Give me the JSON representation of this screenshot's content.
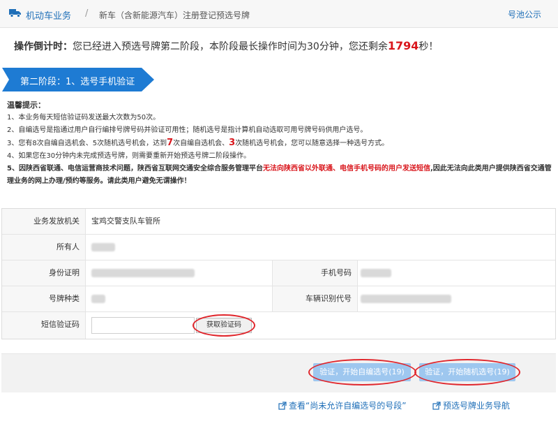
{
  "breadcrumb": {
    "home": "机动车业务",
    "separator": "/",
    "current": "新车（含新能源汽车）注册登记预选号牌",
    "right_link": "号池公示"
  },
  "countdown": {
    "label": "操作倒计时：",
    "text_before": "您已经进入预选号牌第二阶段，本阶段最长操作时间为30分钟，您还剩余",
    "seconds": "1794",
    "text_after": "秒！"
  },
  "stage": {
    "title": "第二阶段：1、选号手机验证"
  },
  "tips": {
    "title": "温馨提示：",
    "line1": "1、本业务每天短信验证码发送最大次数为50次。",
    "line2": "2、自编选号是指通过用户自行编排号牌号码并验证可用性；随机选号是指计算机自动选取可用号牌号码供用户选号。",
    "line3_a": "3、您有8次自编自选机会、5次随机选号机会，达到",
    "line3_n1": "7",
    "line3_b": "次自编自选机会、",
    "line3_n2": "3",
    "line3_c": "次随机选号机会，您可以随意选择一种选号方式。",
    "line4": "4、如果您在30分钟内未完成预选号牌，则需要重新开始预选号牌二阶段操作。",
    "line5_a": "5、因陕西省联通、电信运营商技术问题，陕西省互联网交通安全综合服务管理平台",
    "line5_red": "无法向陕西省以外联通、电信手机号码的用户发送短信",
    "line5_b": ",因此无法向此类用户提供陕西省交通管理业务的网上办理/预约等服务。请此类用户避免无谓操作！"
  },
  "form": {
    "office_label": "业务发放机关",
    "office_value": "宝鸡交警支队车管所",
    "owner_label": "所有人",
    "id_label": "身份证明",
    "phone_label": "手机号码",
    "plate_type_label": "号牌种类",
    "vin_label": "车辆识别代号",
    "sms_label": "短信验证码",
    "sms_placeholder": "",
    "get_code_button": "获取验证码"
  },
  "actions": {
    "self_select_button": "验证，开始自编选号(19)",
    "random_select_button": "验证，开始随机选号(19)"
  },
  "footer": {
    "link_view_unallowed": "查看“尚未允许自编选号的号段”",
    "link_guide": "预选号牌业务导航"
  },
  "colors": {
    "brand_blue": "#1f6fb8",
    "banner_blue": "#1e7bd3",
    "alert_red": "#d9161c",
    "button_blue": "#9ec7ef"
  }
}
